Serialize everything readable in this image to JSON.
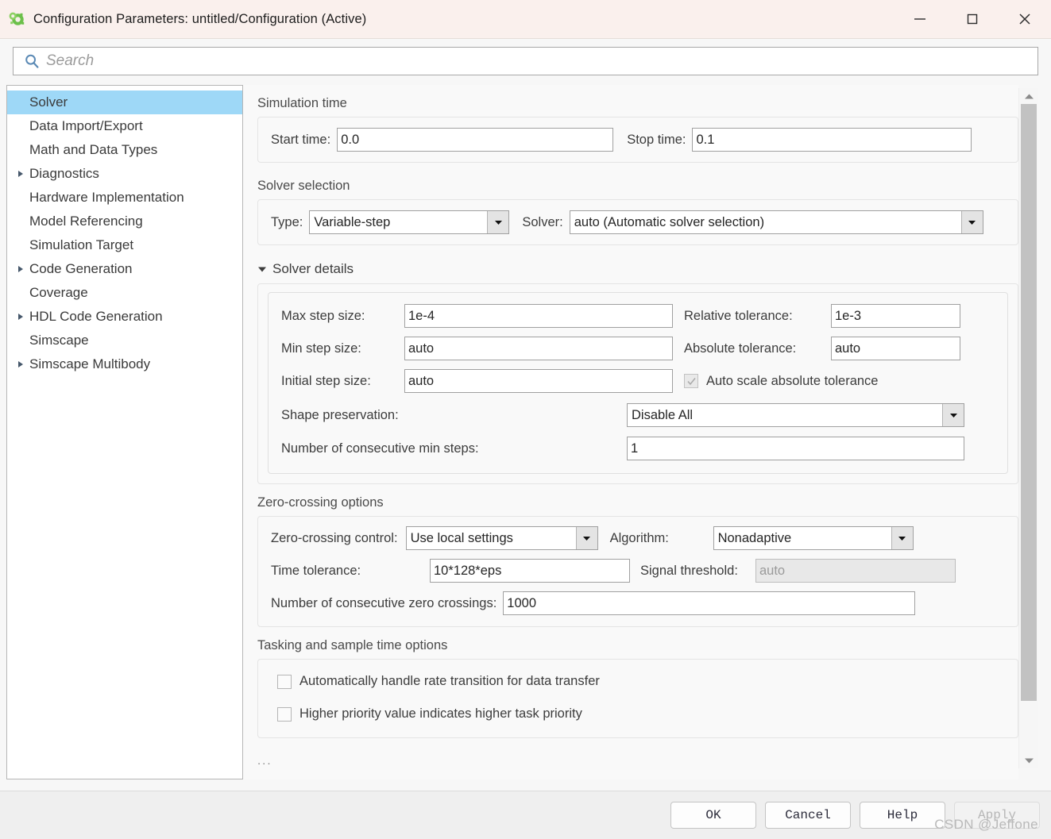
{
  "window": {
    "title": "Configuration Parameters: untitled/Configuration (Active)",
    "app_icon": "simulink-gear-icon",
    "controls": {
      "minimize": "minimize-icon",
      "maximize": "maximize-icon",
      "close": "close-icon"
    }
  },
  "search": {
    "placeholder": "Search",
    "value": "",
    "icon": "search-icon"
  },
  "sidebar": {
    "items": [
      {
        "label": "Solver",
        "expandable": false,
        "selected": true
      },
      {
        "label": "Data Import/Export",
        "expandable": false,
        "selected": false
      },
      {
        "label": "Math and Data Types",
        "expandable": false,
        "selected": false
      },
      {
        "label": "Diagnostics",
        "expandable": true,
        "selected": false
      },
      {
        "label": "Hardware Implementation",
        "expandable": false,
        "selected": false
      },
      {
        "label": "Model Referencing",
        "expandable": false,
        "selected": false
      },
      {
        "label": "Simulation Target",
        "expandable": false,
        "selected": false
      },
      {
        "label": "Code Generation",
        "expandable": true,
        "selected": false
      },
      {
        "label": "Coverage",
        "expandable": false,
        "selected": false
      },
      {
        "label": "HDL Code Generation",
        "expandable": true,
        "selected": false
      },
      {
        "label": "Simscape",
        "expandable": false,
        "selected": false
      },
      {
        "label": "Simscape Multibody",
        "expandable": true,
        "selected": false
      }
    ]
  },
  "main": {
    "simulation_time": {
      "group_label": "Simulation time",
      "start_time_label": "Start time:",
      "start_time_value": "0.0",
      "stop_time_label": "Stop time:",
      "stop_time_value": "0.1"
    },
    "solver_selection": {
      "group_label": "Solver selection",
      "type_label": "Type:",
      "type_value": "Variable-step",
      "solver_label": "Solver:",
      "solver_value": "auto (Automatic solver selection)"
    },
    "solver_details": {
      "disclosure_label": "Solver details",
      "expanded": true,
      "max_step_label": "Max step size:",
      "max_step_value": "1e-4",
      "relative_tolerance_label": "Relative tolerance:",
      "relative_tolerance_value": "1e-3",
      "min_step_label": "Min step size:",
      "min_step_value": "auto",
      "absolute_tolerance_label": "Absolute tolerance:",
      "absolute_tolerance_value": "auto",
      "initial_step_label": "Initial step size:",
      "initial_step_value": "auto",
      "auto_scale_label": "Auto scale absolute tolerance",
      "auto_scale_checked": true,
      "auto_scale_enabled": false,
      "shape_preservation_label": "Shape preservation:",
      "shape_preservation_value": "Disable All",
      "consecutive_min_steps_label": "Number of consecutive min steps:",
      "consecutive_min_steps_value": "1"
    },
    "zero_crossing": {
      "group_label": "Zero-crossing options",
      "control_label": "Zero-crossing control:",
      "control_value": "Use local settings",
      "algorithm_label": "Algorithm:",
      "algorithm_value": "Nonadaptive",
      "time_tolerance_label": "Time tolerance:",
      "time_tolerance_value": "10*128*eps",
      "signal_threshold_label": "Signal threshold:",
      "signal_threshold_value": "auto",
      "signal_threshold_enabled": false,
      "consecutive_zc_label": "Number of consecutive zero crossings:",
      "consecutive_zc_value": "1000"
    },
    "tasking": {
      "group_label": "Tasking and sample time options",
      "auto_rate_transition_label": "Automatically handle rate transition for data transfer",
      "auto_rate_transition_checked": false,
      "higher_priority_label": "Higher priority value indicates higher task priority",
      "higher_priority_checked": false
    },
    "overflow_indicator": "..."
  },
  "footer": {
    "ok_label": "OK",
    "cancel_label": "Cancel",
    "help_label": "Help",
    "apply_label": "Apply",
    "apply_enabled": false
  },
  "watermark": "CSDN @Jeffone",
  "colors": {
    "titlebar": "#faf0ed",
    "selection": "#9ed8f7",
    "content_bg": "#f9f9f9",
    "footer_bg": "#efefef",
    "accent_icon": "#5b8ab5"
  }
}
